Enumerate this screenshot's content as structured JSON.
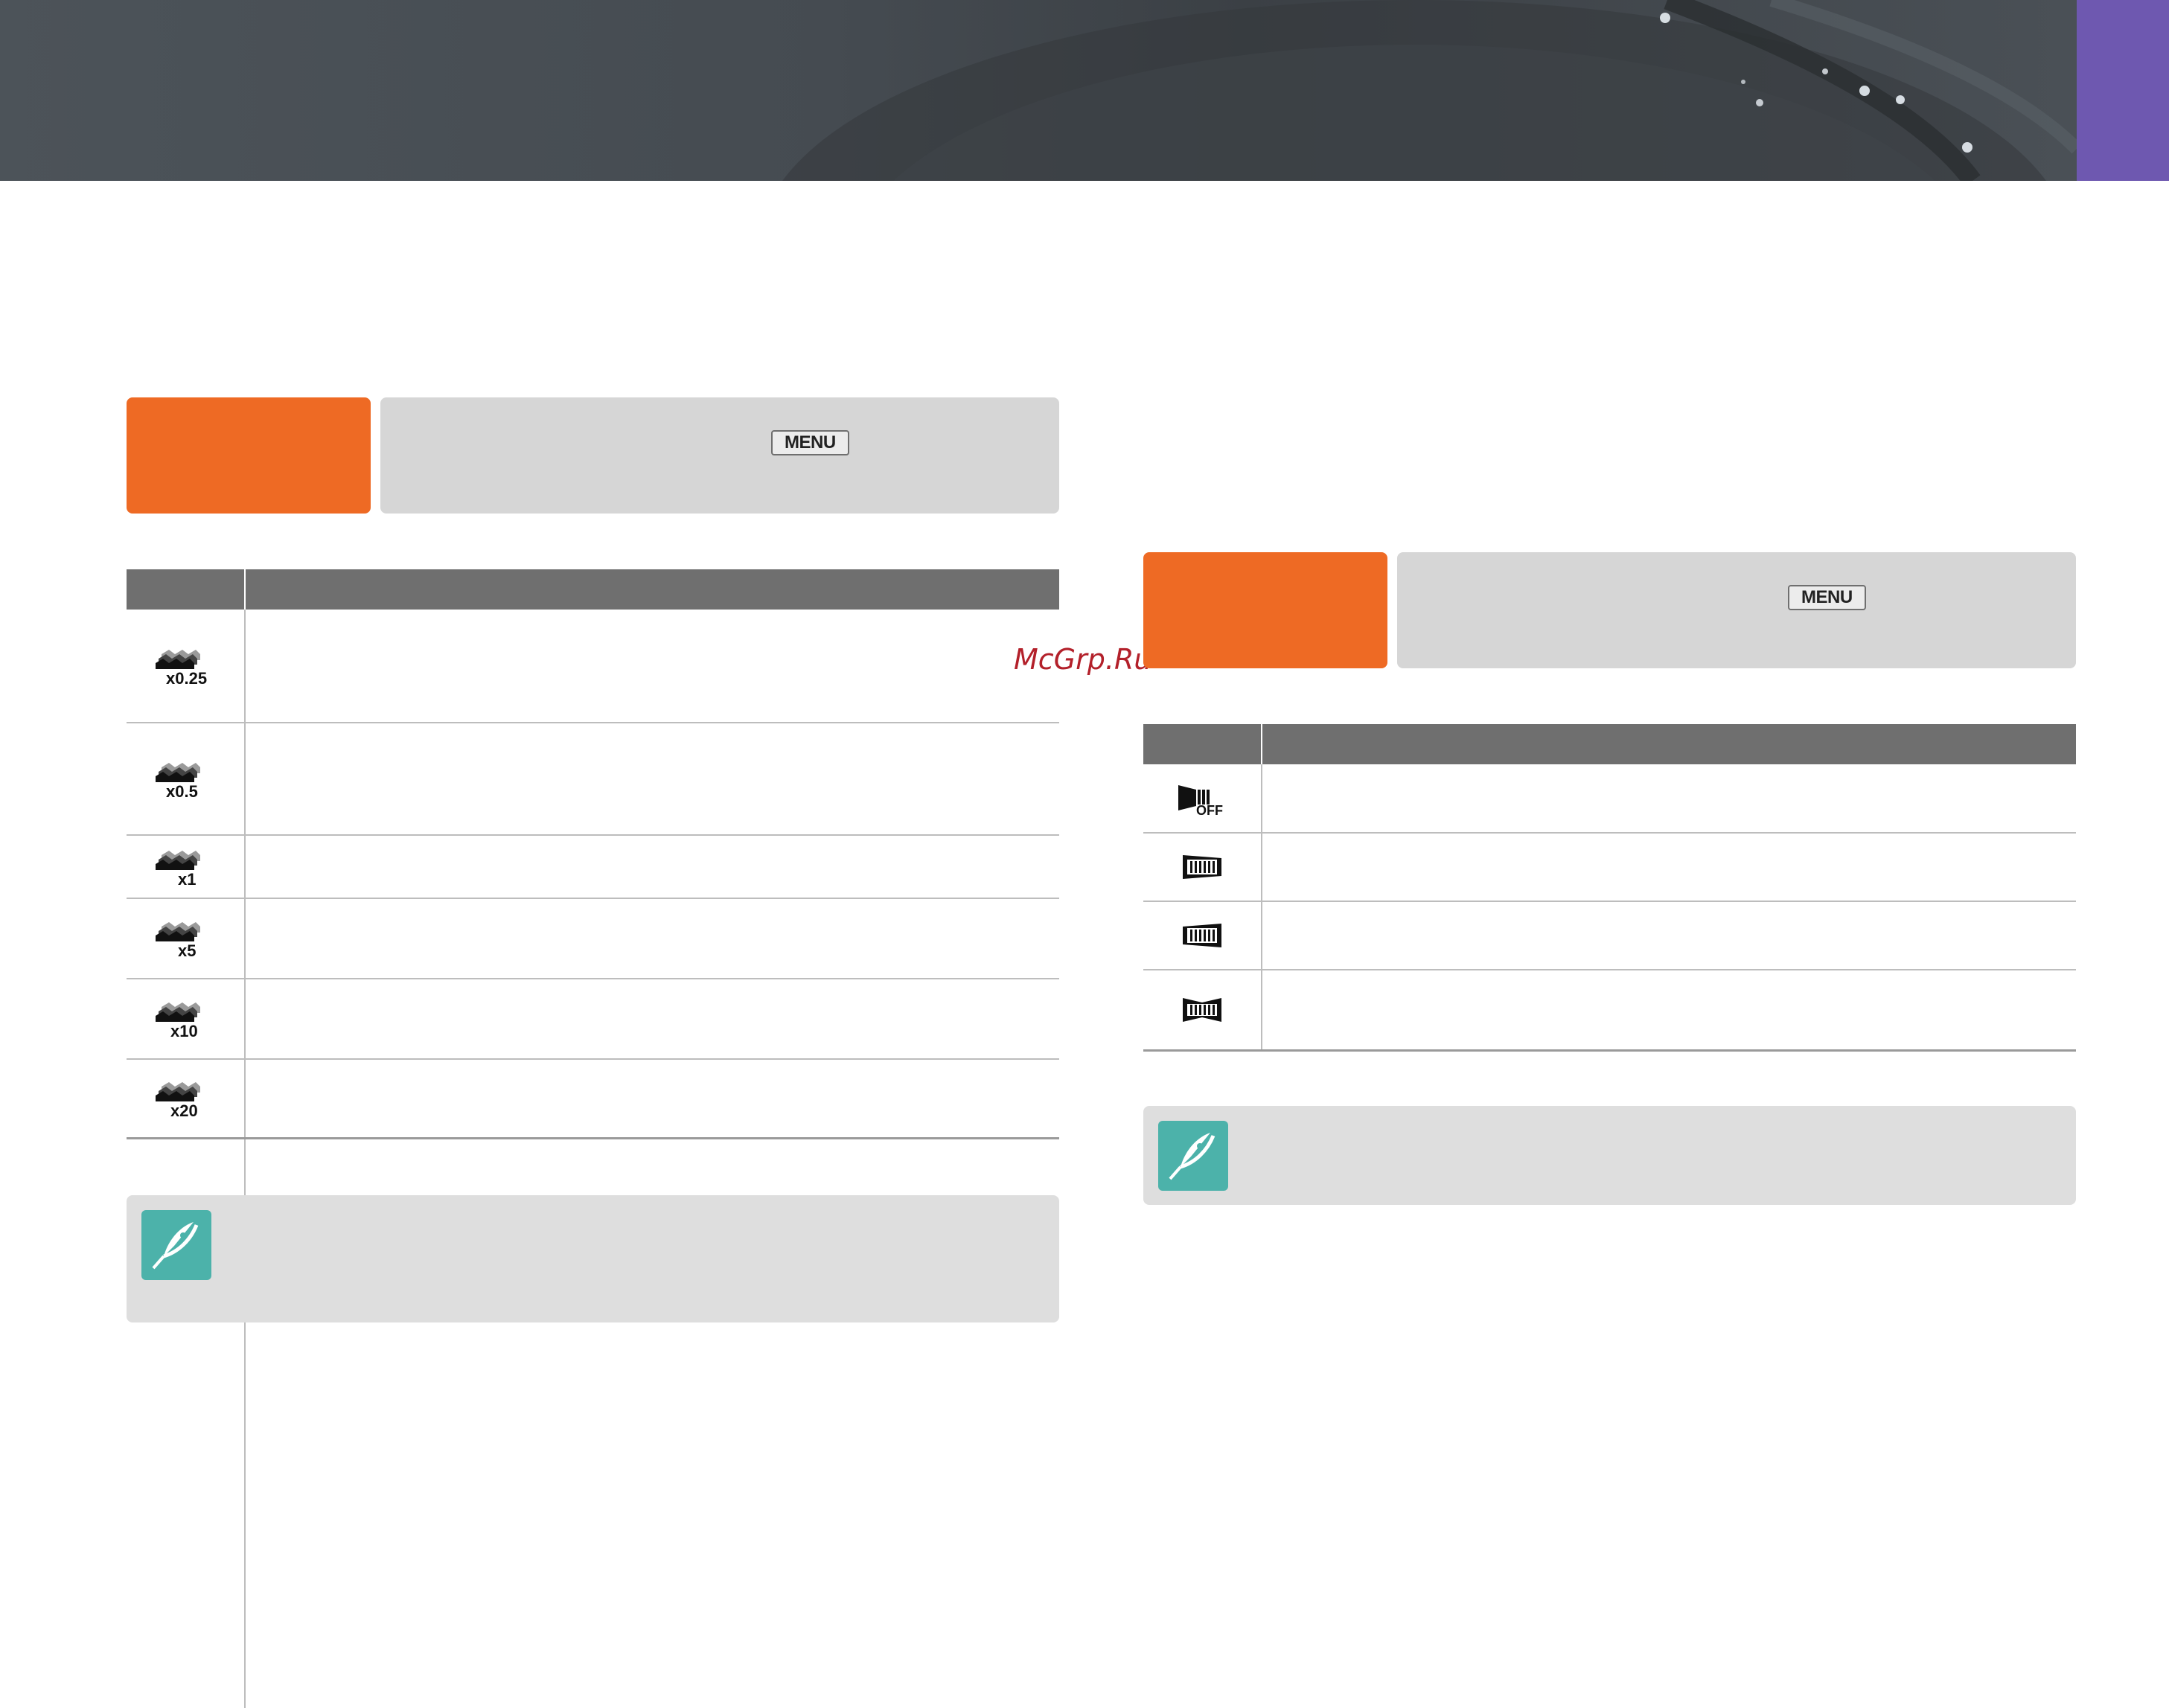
{
  "header": {
    "menu_key_label": "MENU"
  },
  "watermark": "McGrp.Ru",
  "left_table": {
    "rows": [
      {
        "icon": "timelapse-x0.25-icon",
        "label": "x0.25",
        "description": ""
      },
      {
        "icon": "timelapse-x0.5-icon",
        "label": "x0.5",
        "description": ""
      },
      {
        "icon": "timelapse-x1-icon",
        "label": "x1",
        "description": ""
      },
      {
        "icon": "timelapse-x5-icon",
        "label": "x5",
        "description": ""
      },
      {
        "icon": "timelapse-x10-icon",
        "label": "x10",
        "description": ""
      },
      {
        "icon": "timelapse-x20-icon",
        "label": "x20",
        "description": ""
      }
    ]
  },
  "right_table": {
    "rows": [
      {
        "icon": "fader-off-icon",
        "label": "OFF",
        "description": ""
      },
      {
        "icon": "fader-in-icon",
        "label": "",
        "description": ""
      },
      {
        "icon": "fader-out-icon",
        "label": "",
        "description": ""
      },
      {
        "icon": "fader-in-out-icon",
        "label": "",
        "description": ""
      }
    ]
  },
  "notes": [
    {
      "icon": "pen-note-icon",
      "text": ""
    },
    {
      "icon": "pen-note-icon",
      "text": ""
    }
  ],
  "colors": {
    "accent_orange": "#ee6a24",
    "tab_purple": "#6e58b0",
    "table_header": "#6f6f6f",
    "note_icon": "#4cb2aa"
  }
}
